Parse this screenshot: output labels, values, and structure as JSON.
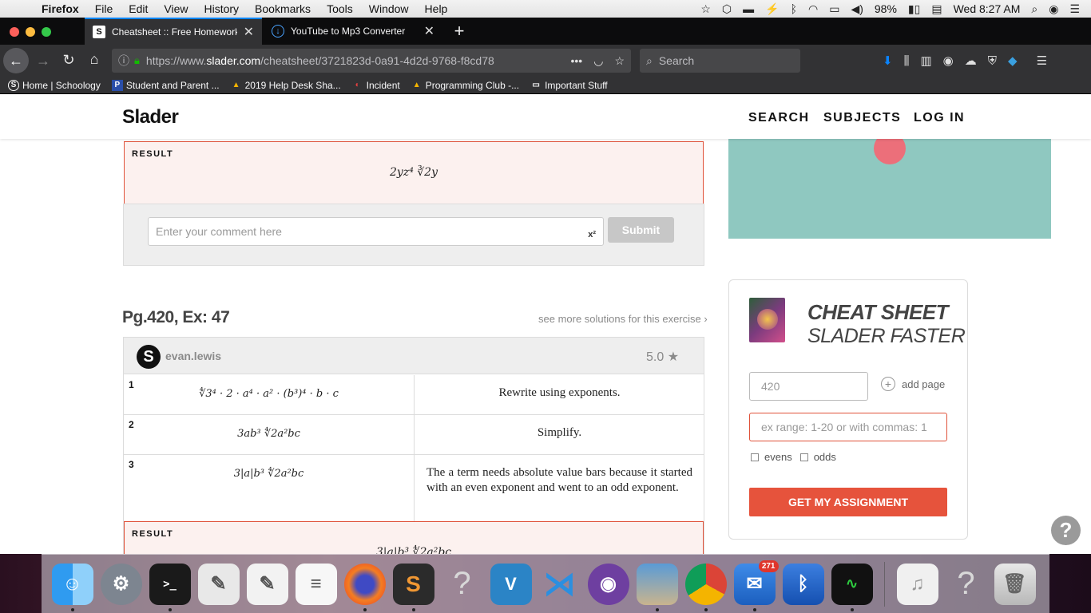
{
  "menubar": {
    "app": "Firefox",
    "items": [
      "File",
      "Edit",
      "View",
      "History",
      "Bookmarks",
      "Tools",
      "Window",
      "Help"
    ],
    "battery": "98%",
    "clock": "Wed 8:27 AM"
  },
  "tabs": [
    {
      "title": "Cheatsheet :: Free Homework H",
      "favicon": "S",
      "active": true
    },
    {
      "title": "YouTube to Mp3 Converter",
      "favicon": "↓",
      "active": false
    }
  ],
  "url": {
    "prefix": "https://www.",
    "host": "slader.com",
    "path": "/cheatsheet/3721823d-0a91-4d2d-9768-f8cd78"
  },
  "search": {
    "placeholder": "Search"
  },
  "bookmarks": [
    {
      "label": "Home | Schoology",
      "icon": "S"
    },
    {
      "label": "Student and Parent ...",
      "icon": "P"
    },
    {
      "label": "2019 Help Desk Sha...",
      "icon": "▲"
    },
    {
      "label": "Incident",
      "icon": "◐"
    },
    {
      "label": "Programming Club -...",
      "icon": "▲"
    },
    {
      "label": "Important Stuff",
      "icon": "▭"
    }
  ],
  "site": {
    "logo": "Slader",
    "nav": [
      "SEARCH",
      "SUBJECTS",
      "LOG IN"
    ]
  },
  "top_result": {
    "label": "RESULT",
    "math": "2yz⁴ ∛2y"
  },
  "comment": {
    "placeholder": "Enter your comment here",
    "sup": "x²",
    "submit": "Submit"
  },
  "exercise": {
    "title": "Pg.420, Ex: 47",
    "see_more": "see more solutions for this exercise ›",
    "author": "evan.lewis",
    "avatar_letter": "S",
    "rating": "5.0",
    "steps": [
      {
        "num": "1",
        "math": "∜3⁴ · 2 · a⁴ · a² · (b³)⁴ · b · c",
        "explanation": "Rewrite using exponents."
      },
      {
        "num": "2",
        "math": "3ab³ ∜2a²bc",
        "explanation": "Simplify."
      },
      {
        "num": "3",
        "math": "3|a|b³ ∜2a²bc",
        "explanation": "The a term needs absolute value bars because it started with an even exponent and went to an odd exponent."
      }
    ],
    "result_label": "RESULT",
    "result_math": "3|a|b³ ∜2a²bc"
  },
  "cheatsheet": {
    "title": "CHEAT SHEET",
    "subtitle": "SLADER FASTER",
    "page_value": "420",
    "add_page": "add page",
    "range_placeholder": "ex range: 1-20  or  with commas: 1",
    "evens": "evens",
    "odds": "odds",
    "button": "GET MY ASSIGNMENT"
  },
  "help_icon": "?",
  "dock": {
    "mail_badge": "271"
  }
}
